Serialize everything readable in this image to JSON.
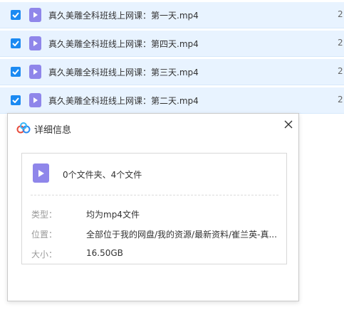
{
  "file_list": {
    "rows": [
      {
        "name": "真久美雕全科班线上网课：第一天.mp4",
        "extra": "2",
        "checked": true
      },
      {
        "name": "真久美雕全科班线上网课：第四天.mp4",
        "extra": "2",
        "checked": true
      },
      {
        "name": "真久美雕全科班线上网课：第三天.mp4",
        "extra": "2",
        "checked": true
      },
      {
        "name": "真久美雕全科班线上网课：第二天.mp4",
        "extra": "2",
        "checked": true
      }
    ],
    "row_color": "#e8f3ff",
    "check_color": "#1b8af2",
    "file_icon": "video-file-icon",
    "file_icon_color": "#8f86ea"
  },
  "dialog": {
    "title": "详细信息",
    "logo_icon": "baidu-netdisk-logo-icon",
    "close_icon": "close-icon",
    "summary": "0个文件夹、4个文件",
    "type_label": "类型：",
    "type_value": "均为mp4文件",
    "location_label": "位置：",
    "location_value": "全部位于我的网盘/我的资源/最新资料/崔兰英-真...",
    "size_label": "大小：",
    "size_value": "16.50GB"
  }
}
